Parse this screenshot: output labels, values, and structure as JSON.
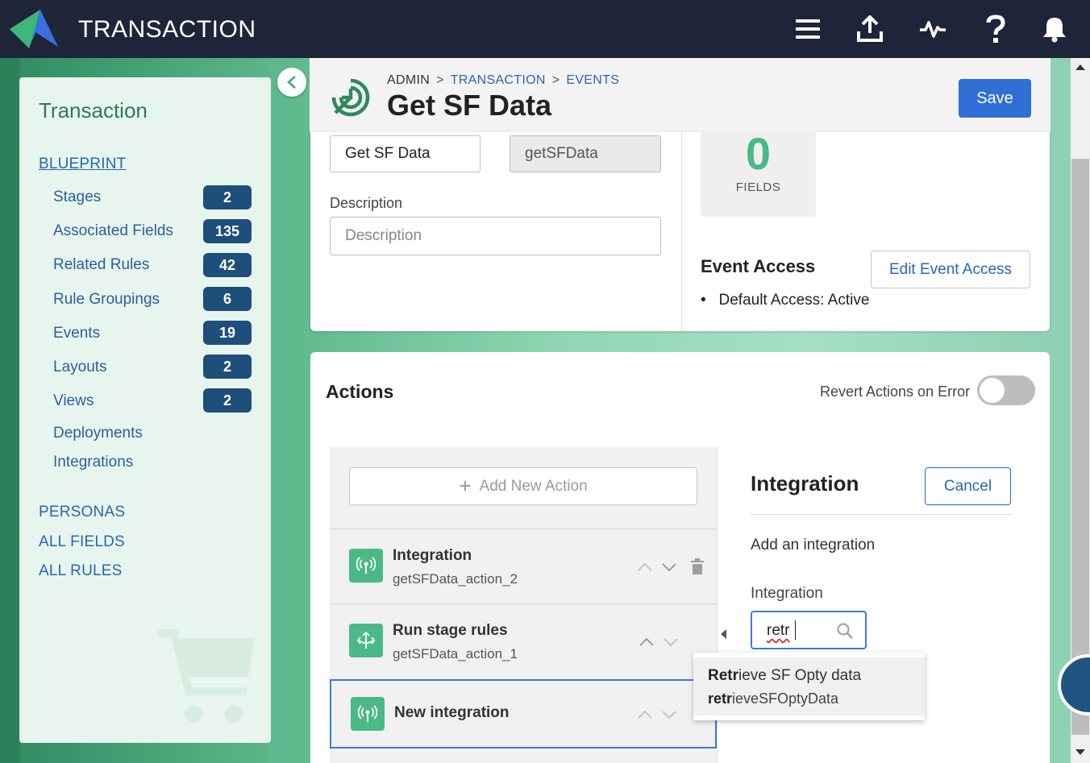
{
  "topbar": {
    "app_title": "TRANSACTION",
    "icons": [
      "menu-icon",
      "upload-icon",
      "activity-icon",
      "help-icon",
      "bell-icon"
    ]
  },
  "sidebar": {
    "title": "Transaction",
    "blueprint_label": "BLUEPRINT",
    "items": [
      {
        "label": "Stages",
        "count": "2"
      },
      {
        "label": "Associated Fields",
        "count": "135"
      },
      {
        "label": "Related Rules",
        "count": "42"
      },
      {
        "label": "Rule Groupings",
        "count": "6"
      },
      {
        "label": "Events",
        "count": "19"
      },
      {
        "label": "Layouts",
        "count": "2"
      },
      {
        "label": "Views",
        "count": "2"
      },
      {
        "label": "Deployments"
      },
      {
        "label": "Integrations"
      }
    ],
    "sections": [
      "PERSONAS",
      "ALL FIELDS",
      "ALL RULES"
    ]
  },
  "header": {
    "breadcrumb": [
      "ADMIN",
      "TRANSACTION",
      "EVENTS"
    ],
    "title": "Get SF Data",
    "save_label": "Save"
  },
  "event_form": {
    "name_value": "Get SF Data",
    "key_value": "getSFData",
    "description_label": "Description",
    "description_placeholder": "Description",
    "fields_count": "0",
    "fields_label": "FIELDS",
    "event_access_title": "Event Access",
    "edit_access_label": "Edit Event Access",
    "default_access": "Default Access: Active"
  },
  "actions": {
    "title": "Actions",
    "revert_label": "Revert Actions on Error",
    "revert_on": false,
    "add_action_label": "Add New Action",
    "list": [
      {
        "name": "Integration",
        "key": "getSFData_action_2",
        "icon": "broadcast-icon"
      },
      {
        "name": "Run stage rules",
        "key": "getSFData_action_1",
        "icon": "flow-icon"
      },
      {
        "name": "New integration",
        "icon": "broadcast-icon",
        "selected": true
      }
    ]
  },
  "integration_panel": {
    "title": "Integration",
    "cancel_label": "Cancel",
    "description": "Add an integration",
    "field_label": "Integration",
    "search_value": "retr",
    "suggestion": {
      "name_match": "Retr",
      "name_rest": "ieve SF Opty data",
      "key_match": "retr",
      "key_rest": "ieveSFOptyData"
    }
  },
  "colors": {
    "topbar": "#1f2539",
    "accent_green": "#4bb985",
    "primary_blue": "#2f6fd6",
    "badge": "#1e4f7a"
  }
}
